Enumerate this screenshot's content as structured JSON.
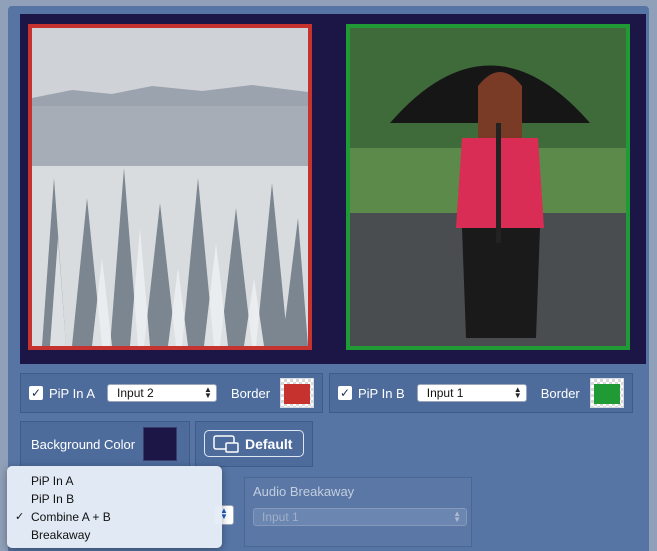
{
  "pip_a": {
    "checkbox_mark": "✓",
    "label": "PiP In A",
    "input_value": "Input 2",
    "border_label": "Border",
    "border_color": "#c6322d"
  },
  "pip_b": {
    "checkbox_mark": "✓",
    "label": "PiP In B",
    "input_value": "Input 1",
    "border_label": "Border",
    "border_color": "#1f9a35"
  },
  "background": {
    "label": "Background Color",
    "color": "#1b1645"
  },
  "default_button": {
    "label": "Default"
  },
  "audio": {
    "title": "Audio Breakaway",
    "value": "Input 1"
  },
  "select_arrows": "▲▼",
  "menu": {
    "items": [
      {
        "label": "PiP In A",
        "checked": ""
      },
      {
        "label": "PiP In B",
        "checked": ""
      },
      {
        "label": "Combine A + B",
        "checked": "✓"
      },
      {
        "label": "Breakaway",
        "checked": ""
      }
    ]
  }
}
